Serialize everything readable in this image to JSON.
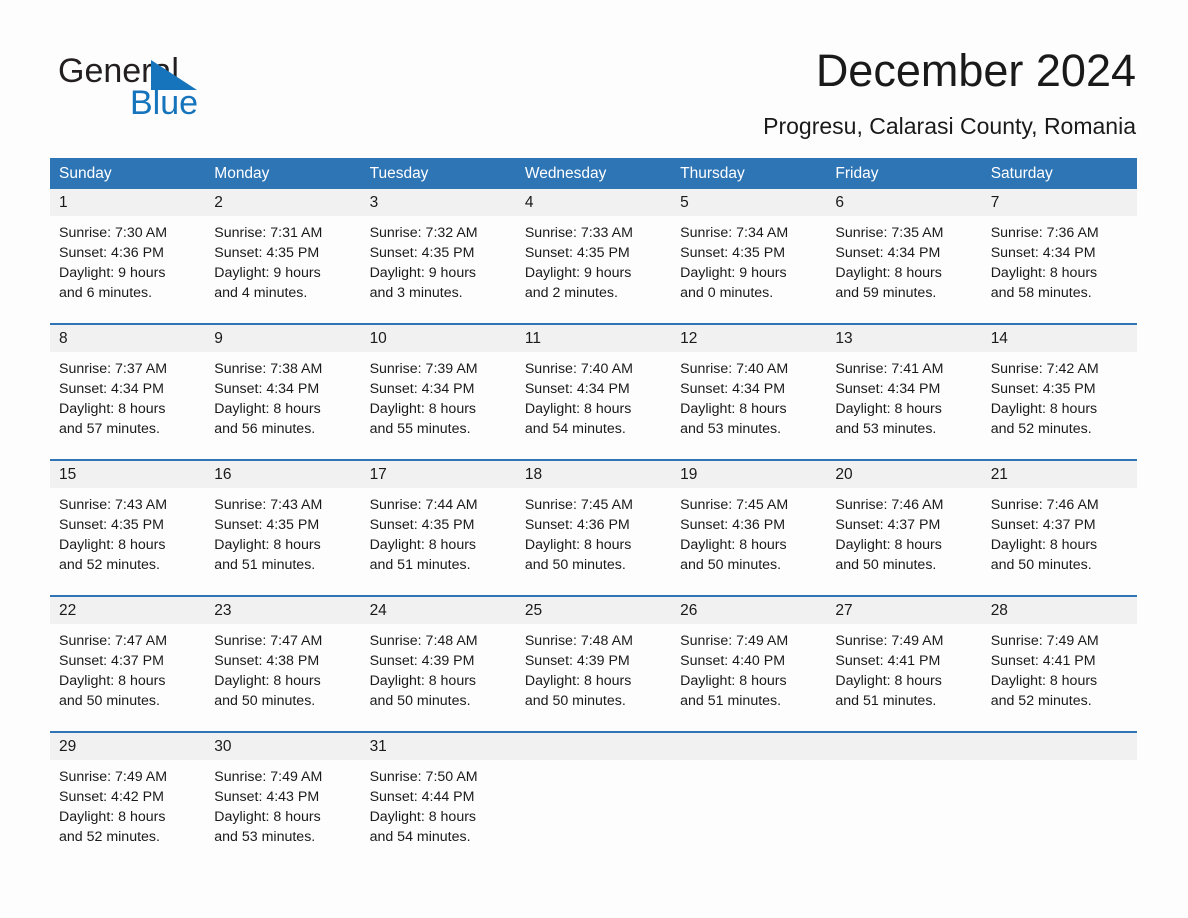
{
  "logo": {
    "word_one": "General",
    "word_two": "Blue",
    "triangle_icon": "triangle-icon",
    "brand_blue": "#1574bb"
  },
  "header": {
    "title": "December 2024",
    "subtitle": "Progresu, Calarasi County, Romania"
  },
  "theme": {
    "header_blue": "#2e75b6",
    "daynum_gray": "#f1f1f1",
    "text": "#1a1a1a"
  },
  "calendar": {
    "weekdays": [
      "Sunday",
      "Monday",
      "Tuesday",
      "Wednesday",
      "Thursday",
      "Friday",
      "Saturday"
    ],
    "weeks": [
      [
        {
          "day": "1",
          "lines": [
            "Sunrise: 7:30 AM",
            "Sunset: 4:36 PM",
            "Daylight: 9 hours",
            "and 6 minutes."
          ]
        },
        {
          "day": "2",
          "lines": [
            "Sunrise: 7:31 AM",
            "Sunset: 4:35 PM",
            "Daylight: 9 hours",
            "and 4 minutes."
          ]
        },
        {
          "day": "3",
          "lines": [
            "Sunrise: 7:32 AM",
            "Sunset: 4:35 PM",
            "Daylight: 9 hours",
            "and 3 minutes."
          ]
        },
        {
          "day": "4",
          "lines": [
            "Sunrise: 7:33 AM",
            "Sunset: 4:35 PM",
            "Daylight: 9 hours",
            "and 2 minutes."
          ]
        },
        {
          "day": "5",
          "lines": [
            "Sunrise: 7:34 AM",
            "Sunset: 4:35 PM",
            "Daylight: 9 hours",
            "and 0 minutes."
          ]
        },
        {
          "day": "6",
          "lines": [
            "Sunrise: 7:35 AM",
            "Sunset: 4:34 PM",
            "Daylight: 8 hours",
            "and 59 minutes."
          ]
        },
        {
          "day": "7",
          "lines": [
            "Sunrise: 7:36 AM",
            "Sunset: 4:34 PM",
            "Daylight: 8 hours",
            "and 58 minutes."
          ]
        }
      ],
      [
        {
          "day": "8",
          "lines": [
            "Sunrise: 7:37 AM",
            "Sunset: 4:34 PM",
            "Daylight: 8 hours",
            "and 57 minutes."
          ]
        },
        {
          "day": "9",
          "lines": [
            "Sunrise: 7:38 AM",
            "Sunset: 4:34 PM",
            "Daylight: 8 hours",
            "and 56 minutes."
          ]
        },
        {
          "day": "10",
          "lines": [
            "Sunrise: 7:39 AM",
            "Sunset: 4:34 PM",
            "Daylight: 8 hours",
            "and 55 minutes."
          ]
        },
        {
          "day": "11",
          "lines": [
            "Sunrise: 7:40 AM",
            "Sunset: 4:34 PM",
            "Daylight: 8 hours",
            "and 54 minutes."
          ]
        },
        {
          "day": "12",
          "lines": [
            "Sunrise: 7:40 AM",
            "Sunset: 4:34 PM",
            "Daylight: 8 hours",
            "and 53 minutes."
          ]
        },
        {
          "day": "13",
          "lines": [
            "Sunrise: 7:41 AM",
            "Sunset: 4:34 PM",
            "Daylight: 8 hours",
            "and 53 minutes."
          ]
        },
        {
          "day": "14",
          "lines": [
            "Sunrise: 7:42 AM",
            "Sunset: 4:35 PM",
            "Daylight: 8 hours",
            "and 52 minutes."
          ]
        }
      ],
      [
        {
          "day": "15",
          "lines": [
            "Sunrise: 7:43 AM",
            "Sunset: 4:35 PM",
            "Daylight: 8 hours",
            "and 52 minutes."
          ]
        },
        {
          "day": "16",
          "lines": [
            "Sunrise: 7:43 AM",
            "Sunset: 4:35 PM",
            "Daylight: 8 hours",
            "and 51 minutes."
          ]
        },
        {
          "day": "17",
          "lines": [
            "Sunrise: 7:44 AM",
            "Sunset: 4:35 PM",
            "Daylight: 8 hours",
            "and 51 minutes."
          ]
        },
        {
          "day": "18",
          "lines": [
            "Sunrise: 7:45 AM",
            "Sunset: 4:36 PM",
            "Daylight: 8 hours",
            "and 50 minutes."
          ]
        },
        {
          "day": "19",
          "lines": [
            "Sunrise: 7:45 AM",
            "Sunset: 4:36 PM",
            "Daylight: 8 hours",
            "and 50 minutes."
          ]
        },
        {
          "day": "20",
          "lines": [
            "Sunrise: 7:46 AM",
            "Sunset: 4:37 PM",
            "Daylight: 8 hours",
            "and 50 minutes."
          ]
        },
        {
          "day": "21",
          "lines": [
            "Sunrise: 7:46 AM",
            "Sunset: 4:37 PM",
            "Daylight: 8 hours",
            "and 50 minutes."
          ]
        }
      ],
      [
        {
          "day": "22",
          "lines": [
            "Sunrise: 7:47 AM",
            "Sunset: 4:37 PM",
            "Daylight: 8 hours",
            "and 50 minutes."
          ]
        },
        {
          "day": "23",
          "lines": [
            "Sunrise: 7:47 AM",
            "Sunset: 4:38 PM",
            "Daylight: 8 hours",
            "and 50 minutes."
          ]
        },
        {
          "day": "24",
          "lines": [
            "Sunrise: 7:48 AM",
            "Sunset: 4:39 PM",
            "Daylight: 8 hours",
            "and 50 minutes."
          ]
        },
        {
          "day": "25",
          "lines": [
            "Sunrise: 7:48 AM",
            "Sunset: 4:39 PM",
            "Daylight: 8 hours",
            "and 50 minutes."
          ]
        },
        {
          "day": "26",
          "lines": [
            "Sunrise: 7:49 AM",
            "Sunset: 4:40 PM",
            "Daylight: 8 hours",
            "and 51 minutes."
          ]
        },
        {
          "day": "27",
          "lines": [
            "Sunrise: 7:49 AM",
            "Sunset: 4:41 PM",
            "Daylight: 8 hours",
            "and 51 minutes."
          ]
        },
        {
          "day": "28",
          "lines": [
            "Sunrise: 7:49 AM",
            "Sunset: 4:41 PM",
            "Daylight: 8 hours",
            "and 52 minutes."
          ]
        }
      ],
      [
        {
          "day": "29",
          "lines": [
            "Sunrise: 7:49 AM",
            "Sunset: 4:42 PM",
            "Daylight: 8 hours",
            "and 52 minutes."
          ]
        },
        {
          "day": "30",
          "lines": [
            "Sunrise: 7:49 AM",
            "Sunset: 4:43 PM",
            "Daylight: 8 hours",
            "and 53 minutes."
          ]
        },
        {
          "day": "31",
          "lines": [
            "Sunrise: 7:50 AM",
            "Sunset: 4:44 PM",
            "Daylight: 8 hours",
            "and 54 minutes."
          ]
        },
        {
          "day": "",
          "lines": []
        },
        {
          "day": "",
          "lines": []
        },
        {
          "day": "",
          "lines": []
        },
        {
          "day": "",
          "lines": []
        }
      ]
    ]
  }
}
